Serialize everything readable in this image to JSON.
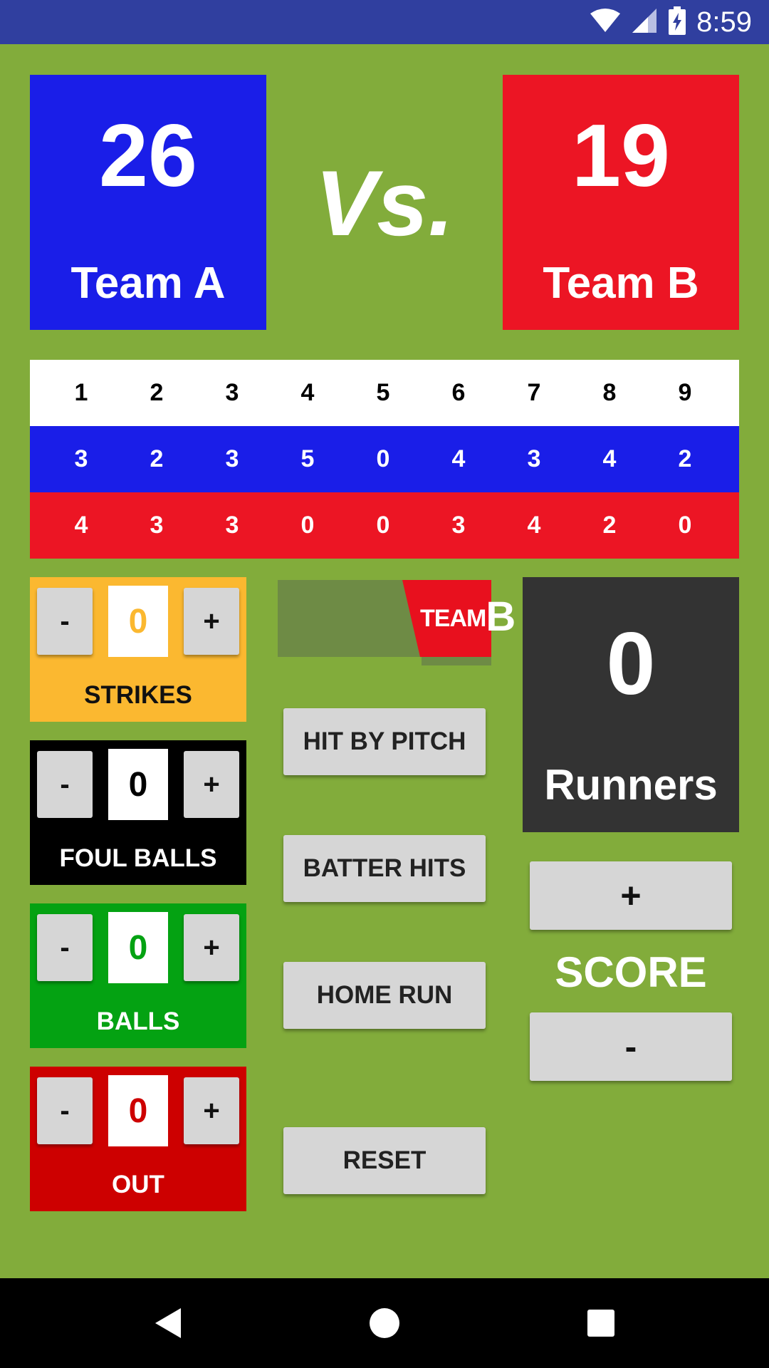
{
  "status_bar": {
    "time": "8:59",
    "icons": [
      "wifi-icon",
      "signal-icon",
      "battery-charging-icon"
    ]
  },
  "team_a": {
    "score": "26",
    "name": "Team A",
    "color": "#1A1EE8"
  },
  "vs_label": "Vs.",
  "team_b": {
    "score": "19",
    "name": "Team B",
    "color": "#EC1524"
  },
  "innings": {
    "headers": [
      "1",
      "2",
      "3",
      "4",
      "5",
      "6",
      "7",
      "8",
      "9"
    ],
    "team_a_runs": [
      "3",
      "2",
      "3",
      "5",
      "0",
      "4",
      "3",
      "4",
      "2"
    ],
    "team_b_runs": [
      "4",
      "3",
      "3",
      "0",
      "0",
      "3",
      "4",
      "2",
      "0"
    ]
  },
  "counters": {
    "strikes": {
      "label": "STRIKES",
      "value": "0",
      "minus": "-",
      "plus": "+",
      "color": "#FBB830"
    },
    "foul_balls": {
      "label": "FOUL BALLS",
      "value": "0",
      "minus": "-",
      "plus": "+",
      "color": "#000000"
    },
    "balls": {
      "label": "BALLS",
      "value": "0",
      "minus": "-",
      "plus": "+",
      "color": "#04A212"
    },
    "out": {
      "label": "OUT",
      "value": "0",
      "minus": "-",
      "plus": "+",
      "color": "#CD0000"
    }
  },
  "team_toggle": {
    "text_small": "TEAM",
    "text_big": "B"
  },
  "actions": {
    "hit_by_pitch": "HIT BY PITCH",
    "batter_hits": "BATTER HITS",
    "home_run": "HOME RUN",
    "reset": "RESET"
  },
  "runners": {
    "value": "0",
    "label": "Runners"
  },
  "score_controls": {
    "plus": "+",
    "label": "SCORE",
    "minus": "-"
  },
  "nav_bar": {
    "icons": [
      "back-icon",
      "home-icon",
      "recents-icon"
    ]
  },
  "colors": {
    "background": "#82AC3B",
    "status_bar": "#303F9F",
    "button": "#D6D6D6",
    "runners_box": "#333333"
  }
}
